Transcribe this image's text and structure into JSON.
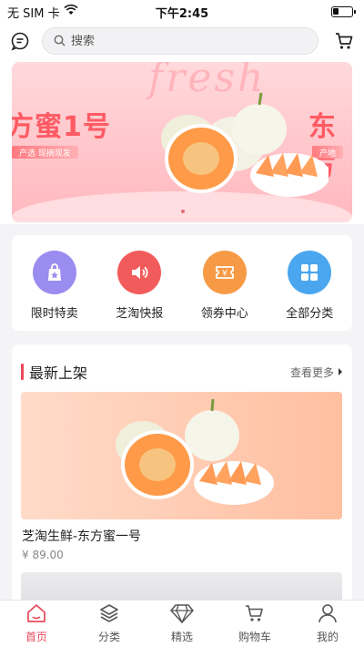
{
  "status_bar": {
    "carrier": "无 SIM 卡",
    "time": "下午2:45"
  },
  "header": {
    "search_placeholder": "搜索"
  },
  "banner": {
    "watermark": "fresh",
    "title_left": "方蜜1号",
    "title_right": "东方",
    "tag_left": "产选  现摘现发",
    "tag_right": "产地"
  },
  "categories": [
    {
      "label": "限时特卖",
      "icon": "flash-sale-bag-icon",
      "color": "#9b8cf0"
    },
    {
      "label": "芝淘快报",
      "icon": "speaker-icon",
      "color": "#f25b5b"
    },
    {
      "label": "领券中心",
      "icon": "coupon-ticket-icon",
      "color": "#f79a46"
    },
    {
      "label": "全部分类",
      "icon": "grid-icon",
      "color": "#4aa7ef"
    }
  ],
  "new_arrivals": {
    "title": "最新上架",
    "more_label": "查看更多",
    "product": {
      "name": "芝淘生鲜-东方蜜一号",
      "price": "¥ 89.00"
    }
  },
  "tabbar": [
    {
      "label": "首页",
      "icon": "home-icon",
      "active": true
    },
    {
      "label": "分类",
      "icon": "layers-icon",
      "active": false
    },
    {
      "label": "精选",
      "icon": "diamond-icon",
      "active": false
    },
    {
      "label": "购物车",
      "icon": "cart-icon",
      "active": false
    },
    {
      "label": "我的",
      "icon": "user-icon",
      "active": false
    }
  ],
  "colors": {
    "accent": "#e94a5b"
  }
}
